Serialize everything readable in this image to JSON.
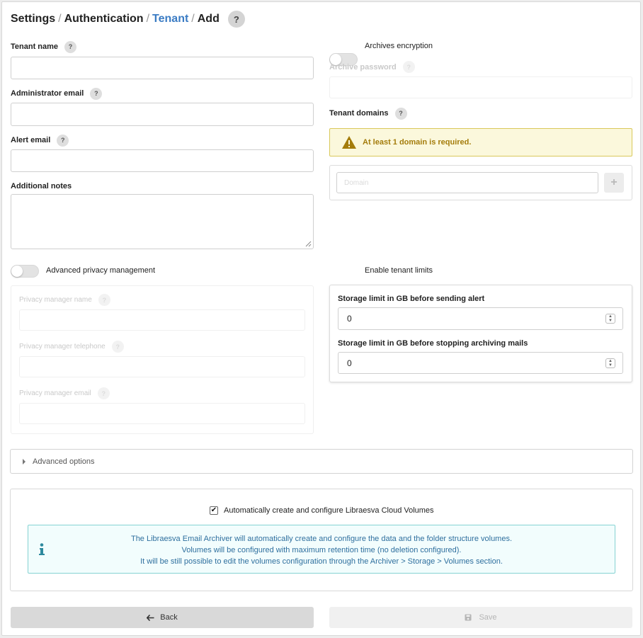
{
  "breadcrumb": {
    "items": [
      "Settings",
      "Authentication",
      "Tenant",
      "Add"
    ],
    "separator": "/",
    "help": "?"
  },
  "form": {
    "tenant_name": {
      "label": "Tenant name",
      "value": ""
    },
    "admin_email": {
      "label": "Administrator email",
      "value": ""
    },
    "alert_email": {
      "label": "Alert email",
      "value": ""
    },
    "notes": {
      "label": "Additional notes",
      "value": ""
    },
    "help": "?"
  },
  "archives_encryption": {
    "label": "Archives encryption",
    "enabled": false
  },
  "archive_password": {
    "label": "Archive password",
    "value": ""
  },
  "tenant_domains": {
    "label": "Tenant domains",
    "warning": "At least 1 domain is required.",
    "domain_placeholder": "Domain",
    "add_label": "+"
  },
  "privacy": {
    "label": "Advanced privacy management",
    "enabled": false,
    "manager_name": "Privacy manager name",
    "manager_telephone": "Privacy manager telephone",
    "manager_email": "Privacy manager email"
  },
  "tenant_limits": {
    "label": "Enable tenant limits",
    "enabled": true,
    "storage_alert_label": "Storage limit in GB before sending alert",
    "storage_alert_value": "0",
    "storage_stop_label": "Storage limit in GB before stopping archiving mails",
    "storage_stop_value": "0"
  },
  "advanced_options": {
    "label": "Advanced options"
  },
  "cloud_volumes": {
    "checkbox_label": "Automatically create and configure Libraesva Cloud Volumes",
    "checked": true,
    "info_lines": [
      "The Libraesva Email Archiver will automatically create and configure the data and the folder structure volumes.",
      "Volumes will be configured with maximum retention time (no deletion configured).",
      "It will be still possible to edit the volumes configuration through the Archiver > Storage > Volumes section."
    ]
  },
  "buttons": {
    "back": "Back",
    "save": "Save"
  },
  "colors": {
    "accent": "#2e7fd2",
    "link": "#3b7cc4",
    "warning": "#a47c0b",
    "info": "#2e6f9e"
  }
}
